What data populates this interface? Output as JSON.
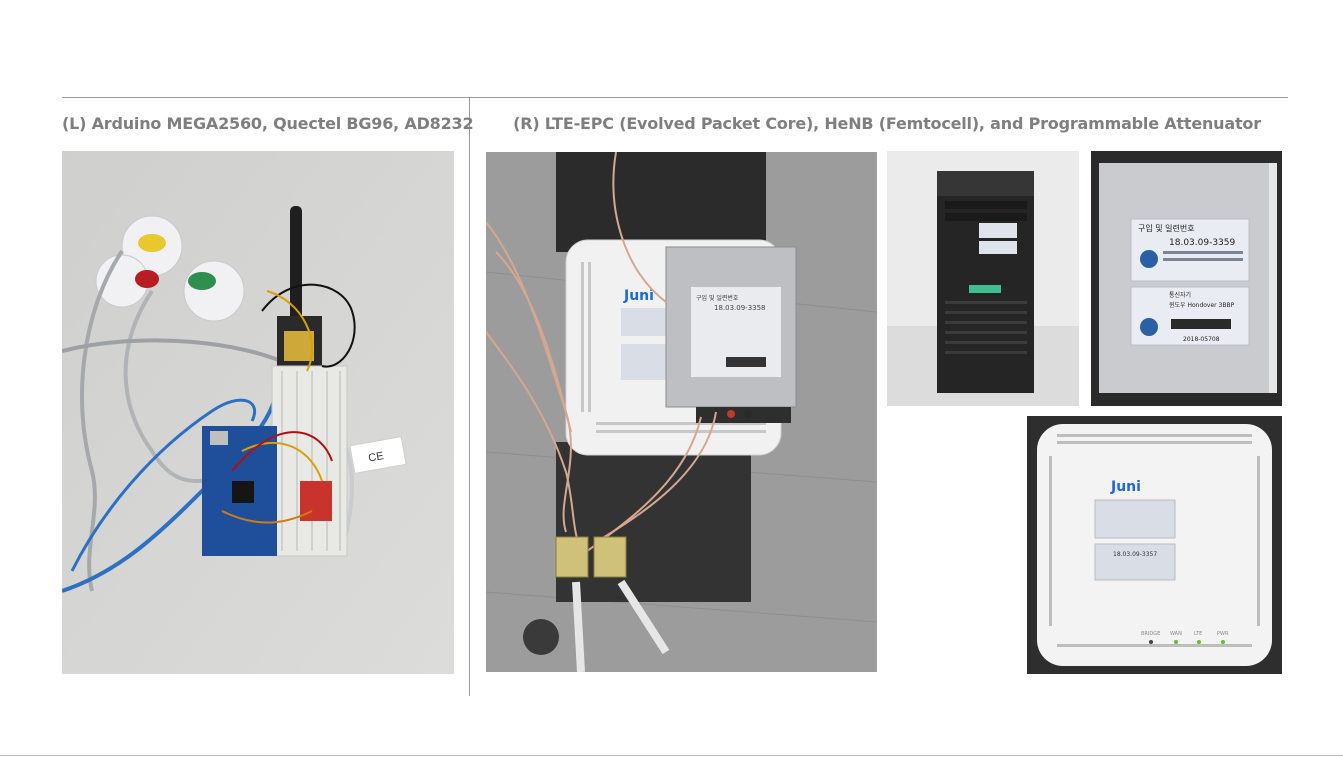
{
  "captions": {
    "left": "(L) Arduino MEGA2560, Quectel BG96, AD8232",
    "right": "(R) LTE-EPC (Evolved Packet Core), HeNB (Femtocell), and Programmable Attenuator"
  },
  "photos": {
    "arduino": {
      "sticker_ce": "CE"
    },
    "epc": {
      "brand": "Juni",
      "label_title": "구입 및 일련번호",
      "label_number": "18.03.09-3358"
    },
    "server": {},
    "server_label": {
      "label_title": "구입 및 일련번호",
      "label_number": "18.03.09-3359",
      "label_line2": "통신자기",
      "label_line3": "윈도우 Hondover 3BBP",
      "label_code": "2018-05708"
    },
    "femtocell": {
      "brand": "Juni",
      "label_number": "18.03.09-3357",
      "led_labels": [
        "BRIDGE",
        "WAN",
        "LTE",
        "PWR"
      ]
    }
  }
}
